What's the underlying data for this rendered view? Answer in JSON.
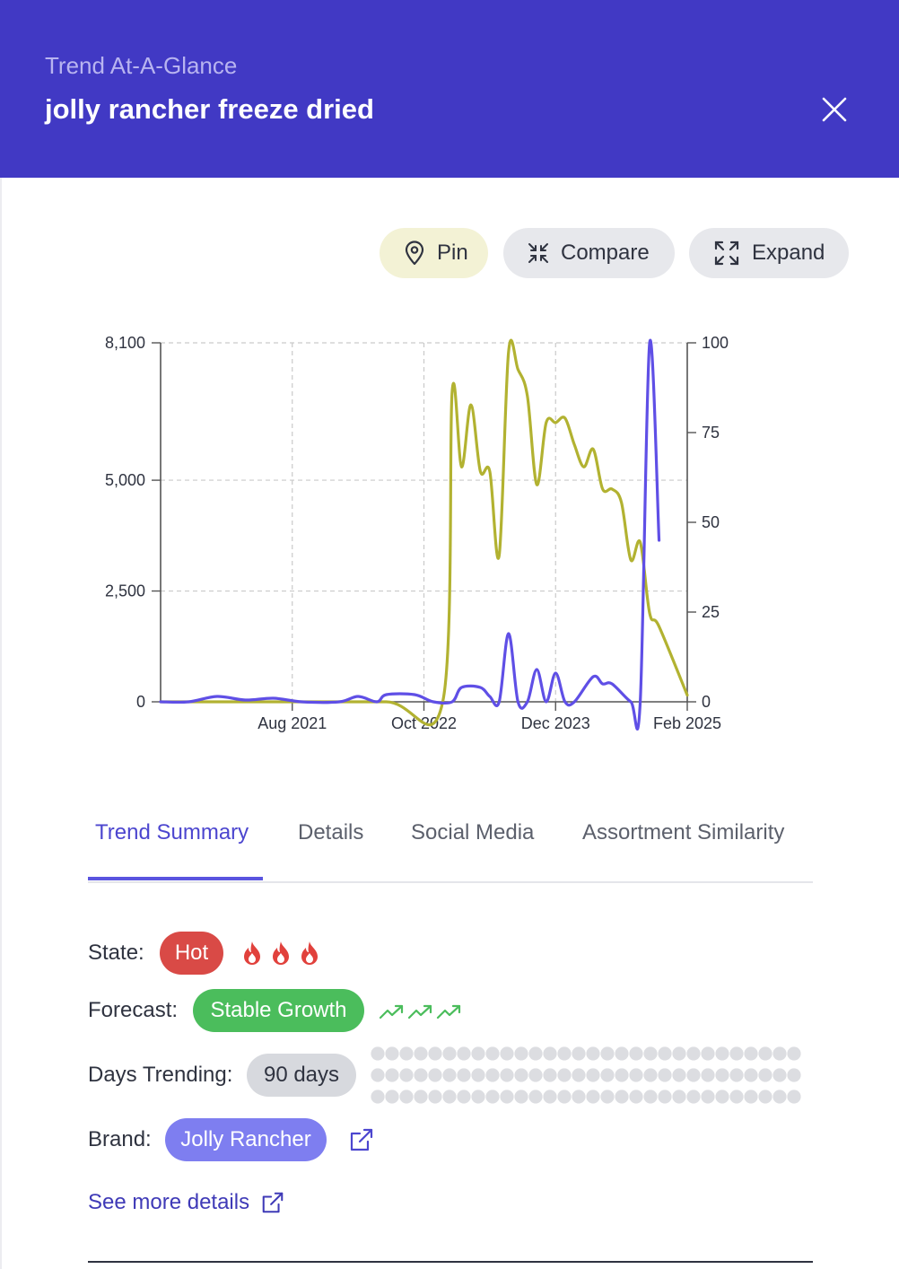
{
  "header": {
    "eyebrow": "Trend At-A-Glance",
    "title": "jolly rancher freeze dried",
    "background": "#4139c4"
  },
  "actions": {
    "pin_label": "Pin",
    "compare_label": "Compare",
    "expand_label": "Expand"
  },
  "chart_data": {
    "type": "line",
    "x_ticks": [
      "Aug 2021",
      "Oct 2022",
      "Dec 2023",
      "Feb 2025"
    ],
    "x_range": [
      "2020-06",
      "2025-02"
    ],
    "y_left": {
      "ticks": [
        "0",
        "2,500",
        "5,000",
        "8,100"
      ],
      "range": [
        0,
        8100
      ]
    },
    "y_right": {
      "ticks": [
        "0",
        "25",
        "50",
        "75",
        "100"
      ],
      "range": [
        0,
        100
      ]
    },
    "grid": true,
    "series": [
      {
        "axis": "left",
        "color": "#b2b231",
        "points": [
          [
            "2020-06",
            0
          ],
          [
            "2021-06",
            0
          ],
          [
            "2022-06",
            0
          ],
          [
            "2022-12",
            0
          ],
          [
            "2023-01",
            7000
          ],
          [
            "2023-02",
            5300
          ],
          [
            "2023-03",
            6700
          ],
          [
            "2023-04",
            5200
          ],
          [
            "2023-05",
            5200
          ],
          [
            "2023-06",
            3300
          ],
          [
            "2023-07",
            7900
          ],
          [
            "2023-08",
            7500
          ],
          [
            "2023-09",
            6900
          ],
          [
            "2023-10",
            4900
          ],
          [
            "2023-11",
            6300
          ],
          [
            "2023-12",
            6300
          ],
          [
            "2024-01",
            6400
          ],
          [
            "2024-02",
            5800
          ],
          [
            "2024-03",
            5300
          ],
          [
            "2024-04",
            5700
          ],
          [
            "2024-05",
            4800
          ],
          [
            "2024-06",
            4800
          ],
          [
            "2024-07",
            4500
          ],
          [
            "2024-08",
            3200
          ],
          [
            "2024-09",
            3600
          ],
          [
            "2024-10",
            2000
          ],
          [
            "2024-11",
            1700
          ],
          [
            "2025-02",
            150
          ]
        ]
      },
      {
        "axis": "right",
        "color": "#5f4fe6",
        "points": [
          [
            "2020-06",
            0
          ],
          [
            "2020-09",
            0
          ],
          [
            "2020-12",
            1.5
          ],
          [
            "2021-03",
            0.5
          ],
          [
            "2021-06",
            1
          ],
          [
            "2021-09",
            0
          ],
          [
            "2022-01",
            0
          ],
          [
            "2022-03",
            1.5
          ],
          [
            "2022-05",
            0
          ],
          [
            "2022-06",
            2
          ],
          [
            "2022-09",
            2
          ],
          [
            "2022-11",
            0
          ],
          [
            "2023-01",
            0
          ],
          [
            "2023-02",
            4
          ],
          [
            "2023-04",
            4
          ],
          [
            "2023-05",
            1.5
          ],
          [
            "2023-06",
            0
          ],
          [
            "2023-07",
            19
          ],
          [
            "2023-08",
            0
          ],
          [
            "2023-09",
            0
          ],
          [
            "2023-10",
            9
          ],
          [
            "2023-11",
            0
          ],
          [
            "2023-12",
            8
          ],
          [
            "2024-01",
            0
          ],
          [
            "2024-02",
            0
          ],
          [
            "2024-04",
            7
          ],
          [
            "2024-05",
            5
          ],
          [
            "2024-06",
            5
          ],
          [
            "2024-08",
            0
          ],
          [
            "2024-09",
            0
          ],
          [
            "2024-10",
            100
          ],
          [
            "2024-11",
            45
          ]
        ]
      }
    ]
  },
  "tabs": [
    {
      "label": "Trend Summary",
      "active": true
    },
    {
      "label": "Details",
      "active": false
    },
    {
      "label": "Social Media",
      "active": false
    },
    {
      "label": "Assortment Similarity",
      "active": false
    }
  ],
  "summary": {
    "state_label": "State:",
    "state_value": "Hot",
    "state_flames": 3,
    "forecast_label": "Forecast:",
    "forecast_value": "Stable Growth",
    "forecast_arrows": 3,
    "days_label": "Days Trending:",
    "days_value": "90 days",
    "brand_label": "Brand:",
    "brand_value": "Jolly Rancher",
    "see_more": "See more details"
  },
  "colors": {
    "accent": "#4c46cf",
    "hot": "#d94a46",
    "growth": "#4bbd5c",
    "brand": "#7e7ef0",
    "flame": "#e1413c",
    "arrow": "#4bbd5c"
  }
}
